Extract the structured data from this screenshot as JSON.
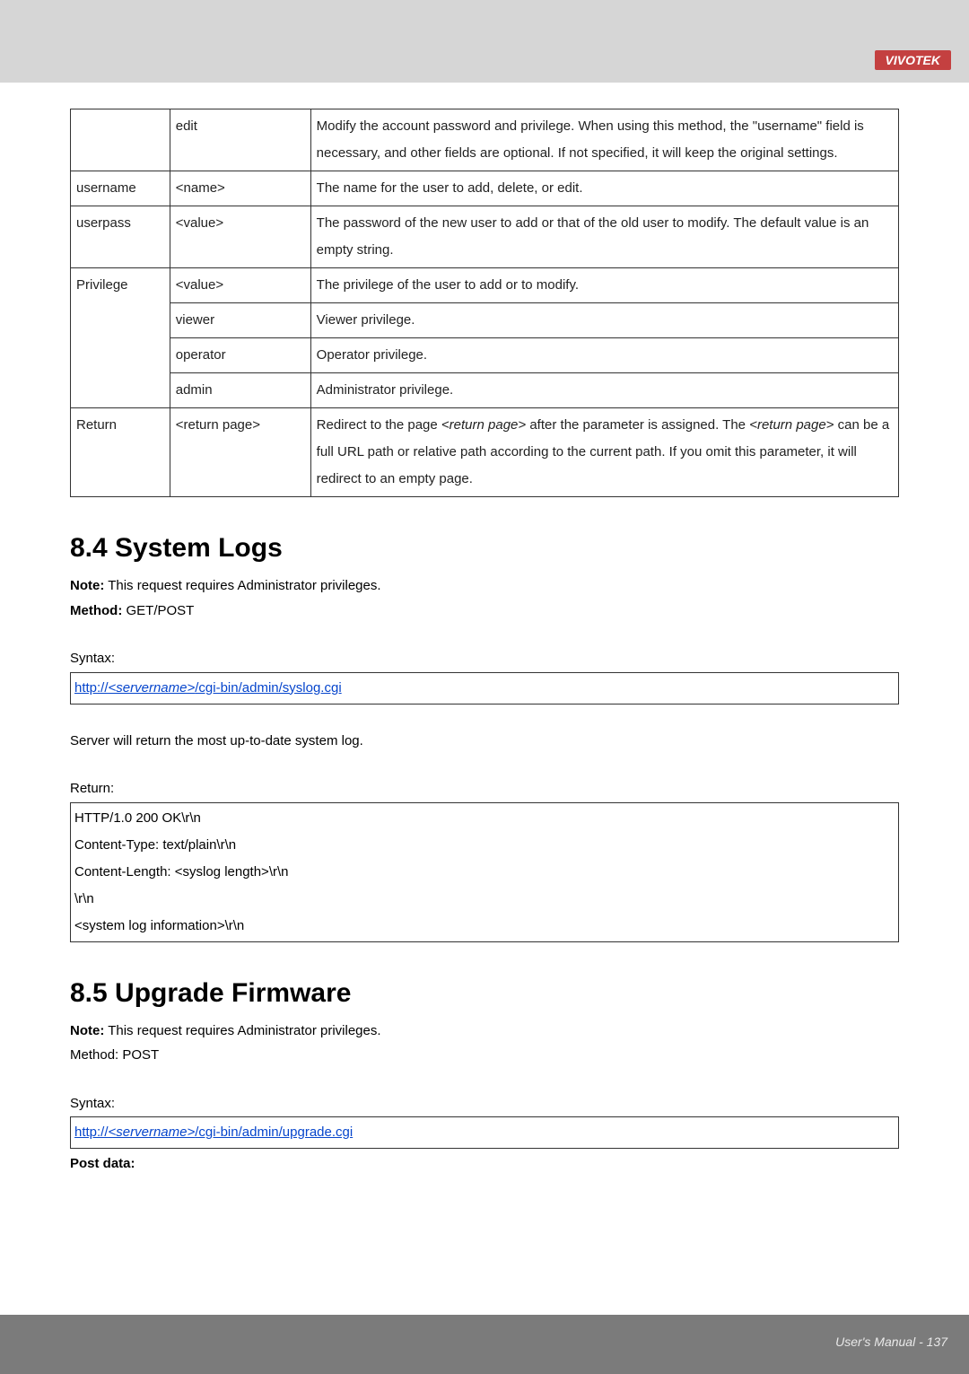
{
  "brand": "VIVOTEK",
  "table": {
    "rows": [
      {
        "c0": "",
        "c1": "edit",
        "c2": "Modify the account password and privilege. When using this method, the \"username\" field is necessary, and other fields are optional. If not specified, it will keep the original settings."
      },
      {
        "c0": "username",
        "c1": "<name>",
        "c2": "The name for the user to add, delete, or edit."
      },
      {
        "c0": "userpass",
        "c1": "<value>",
        "c2": "The password of the new user to add or that of the old user to modify. The default value is an empty string."
      },
      {
        "c0": "Privilege",
        "c1": "<value>",
        "c2": "The privilege of the user to add or to modify."
      },
      {
        "c0": "",
        "c1": "viewer",
        "c2": "Viewer privilege."
      },
      {
        "c0": "",
        "c1": "operator",
        "c2": "Operator privilege."
      },
      {
        "c0": "",
        "c1": "admin",
        "c2": "Administrator privilege."
      },
      {
        "c0": "Return",
        "c1": "<return page>",
        "c2_prefix": "Redirect to the page ",
        "c2_ital1": "<return page>",
        "c2_mid": " after the parameter is assigned. The ",
        "c2_ital2": "<return page>",
        "c2_suffix": " can be a full URL path or relative path according to the current path. If you omit this parameter, it will redirect to an empty page."
      }
    ]
  },
  "sec84": {
    "heading": "8.4 System Logs",
    "note_label": "Note:",
    "note_text": " This request requires Administrator privileges.",
    "method_label": "Method:",
    "method_text": " GET/POST",
    "syntax_label": "Syntax:",
    "url_prefix": "http://",
    "url_server": "<servername>",
    "url_suffix": "/cgi-bin/admin/syslog.cgi",
    "server_line": "Server will return the most up-to-date system log.",
    "return_label": "Return:",
    "return_lines": [
      "HTTP/1.0 200 OK\\r\\n",
      "Content-Type: text/plain\\r\\n",
      "Content-Length: <syslog length>\\r\\n",
      "\\r\\n",
      "<system log information>\\r\\n"
    ]
  },
  "sec85": {
    "heading": "8.5 Upgrade Firmware",
    "note_label": "Note:",
    "note_text": " This request requires Administrator privileges.",
    "method_line": "Method: POST",
    "syntax_label": "Syntax:",
    "url_prefix": "http://",
    "url_server": "<servername>",
    "url_suffix": "/cgi-bin/admin/upgrade.cgi",
    "post_label": "Post data:"
  },
  "footer": "User's Manual - 137"
}
